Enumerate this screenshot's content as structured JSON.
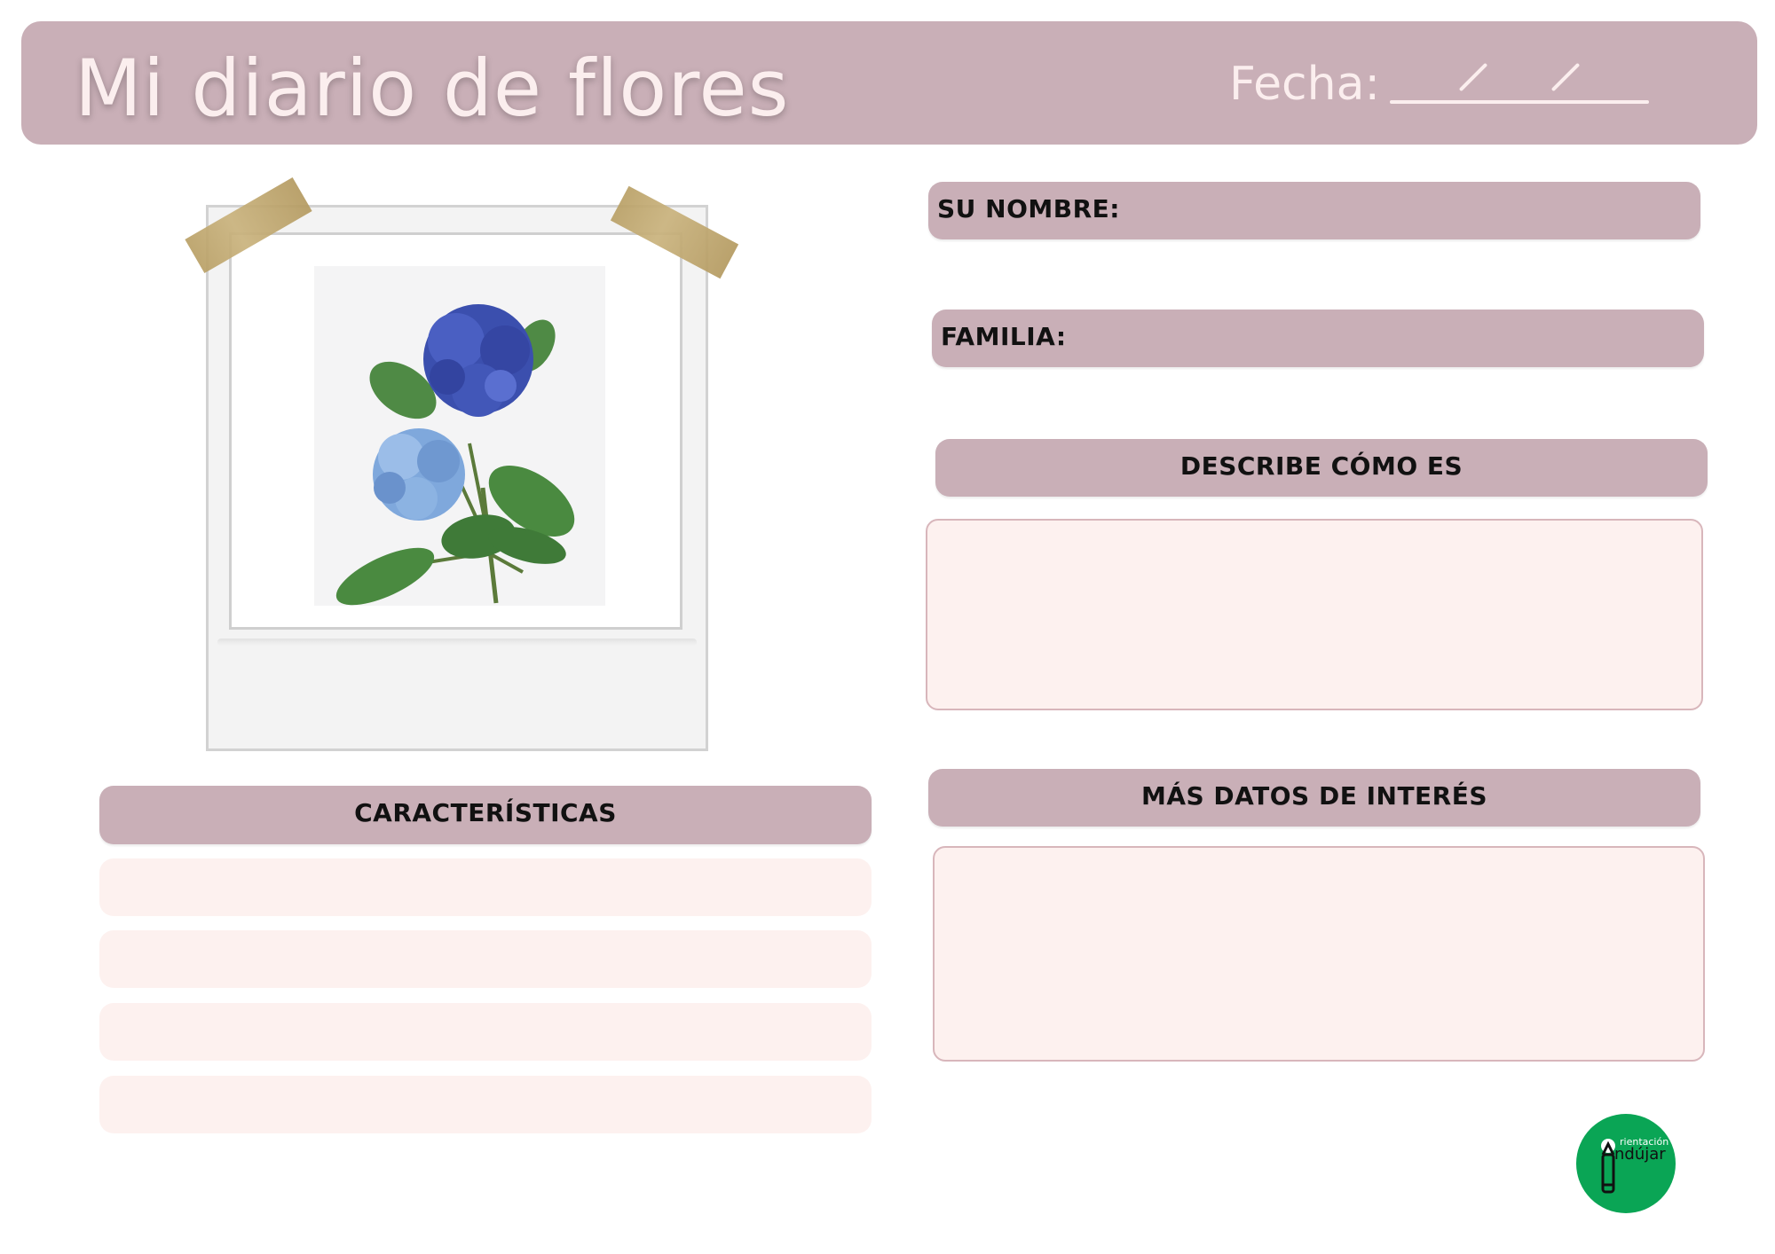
{
  "header": {
    "title": "Mi diario de flores",
    "date_label": "Fecha:"
  },
  "fields": {
    "name_label": "SU NOMBRE:",
    "family_label": "FAMILIA:",
    "describe_label": "DESCRIBE CÓMO ES",
    "characteristics_label": "CARACTERÍSTICAS",
    "more_label": "MÁS DATOS DE INTERÉS"
  },
  "logo": {
    "small_text": "rientación",
    "big_text": "ndújar"
  },
  "colors": {
    "header_bg": "#c9afb7",
    "header_text": "#fbeeee",
    "box_bg": "#fdf1ef",
    "logo_green": "#0aa555"
  },
  "icons": [
    "flower-photo",
    "tape-strip",
    "pencil-icon"
  ]
}
